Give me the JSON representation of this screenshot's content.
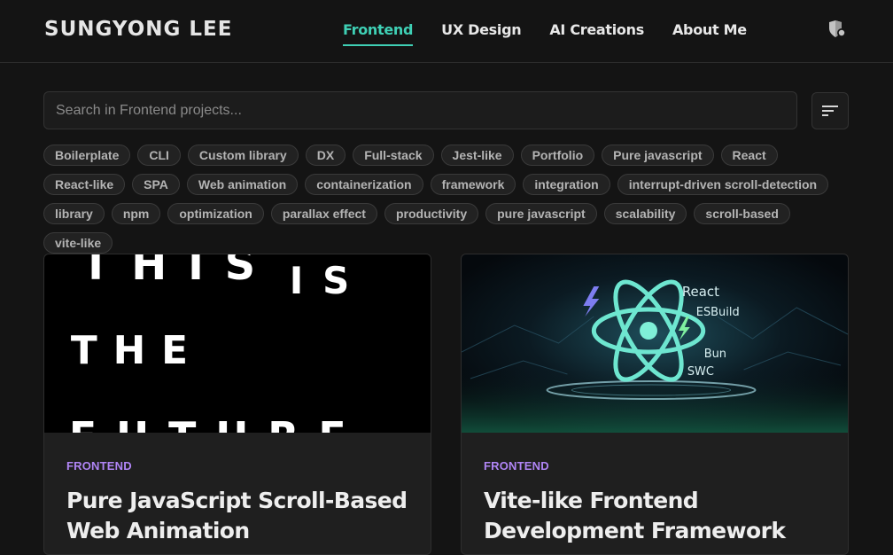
{
  "header": {
    "brand": "SUNGYONG LEE",
    "nav": [
      {
        "label": "Frontend",
        "active": true
      },
      {
        "label": "UX Design",
        "active": false
      },
      {
        "label": "AI Creations",
        "active": false
      },
      {
        "label": "About Me",
        "active": false
      }
    ],
    "theme_icon": "theme-toggle-icon"
  },
  "search": {
    "placeholder": "Search in Frontend projects...",
    "value": ""
  },
  "filter_icon": "sort-filter-icon",
  "tags": [
    "Boilerplate",
    "CLI",
    "Custom library",
    "DX",
    "Full-stack",
    "Jest-like",
    "Portfolio",
    "Pure javascript",
    "React",
    "React-like",
    "SPA",
    "Web animation",
    "containerization",
    "framework",
    "integration",
    "interrupt-driven scroll-detection",
    "library",
    "npm",
    "optimization",
    "parallax effect",
    "productivity",
    "pure javascript",
    "scalability",
    "scroll-based",
    "vite-like"
  ],
  "cards": [
    {
      "category": "FRONTEND",
      "title": "Pure JavaScript Scroll-Based Web Animation",
      "image_text": [
        "THIS",
        "IS",
        "THE",
        "FUTURE"
      ]
    },
    {
      "category": "FRONTEND",
      "title": "Vite-like Frontend Development Framework",
      "image_labels": [
        "React",
        "ESBuild",
        "Bun",
        "SWC"
      ]
    }
  ],
  "colors": {
    "accent": "#3fd0b5",
    "category": "#b085f5",
    "background": "#141414"
  }
}
